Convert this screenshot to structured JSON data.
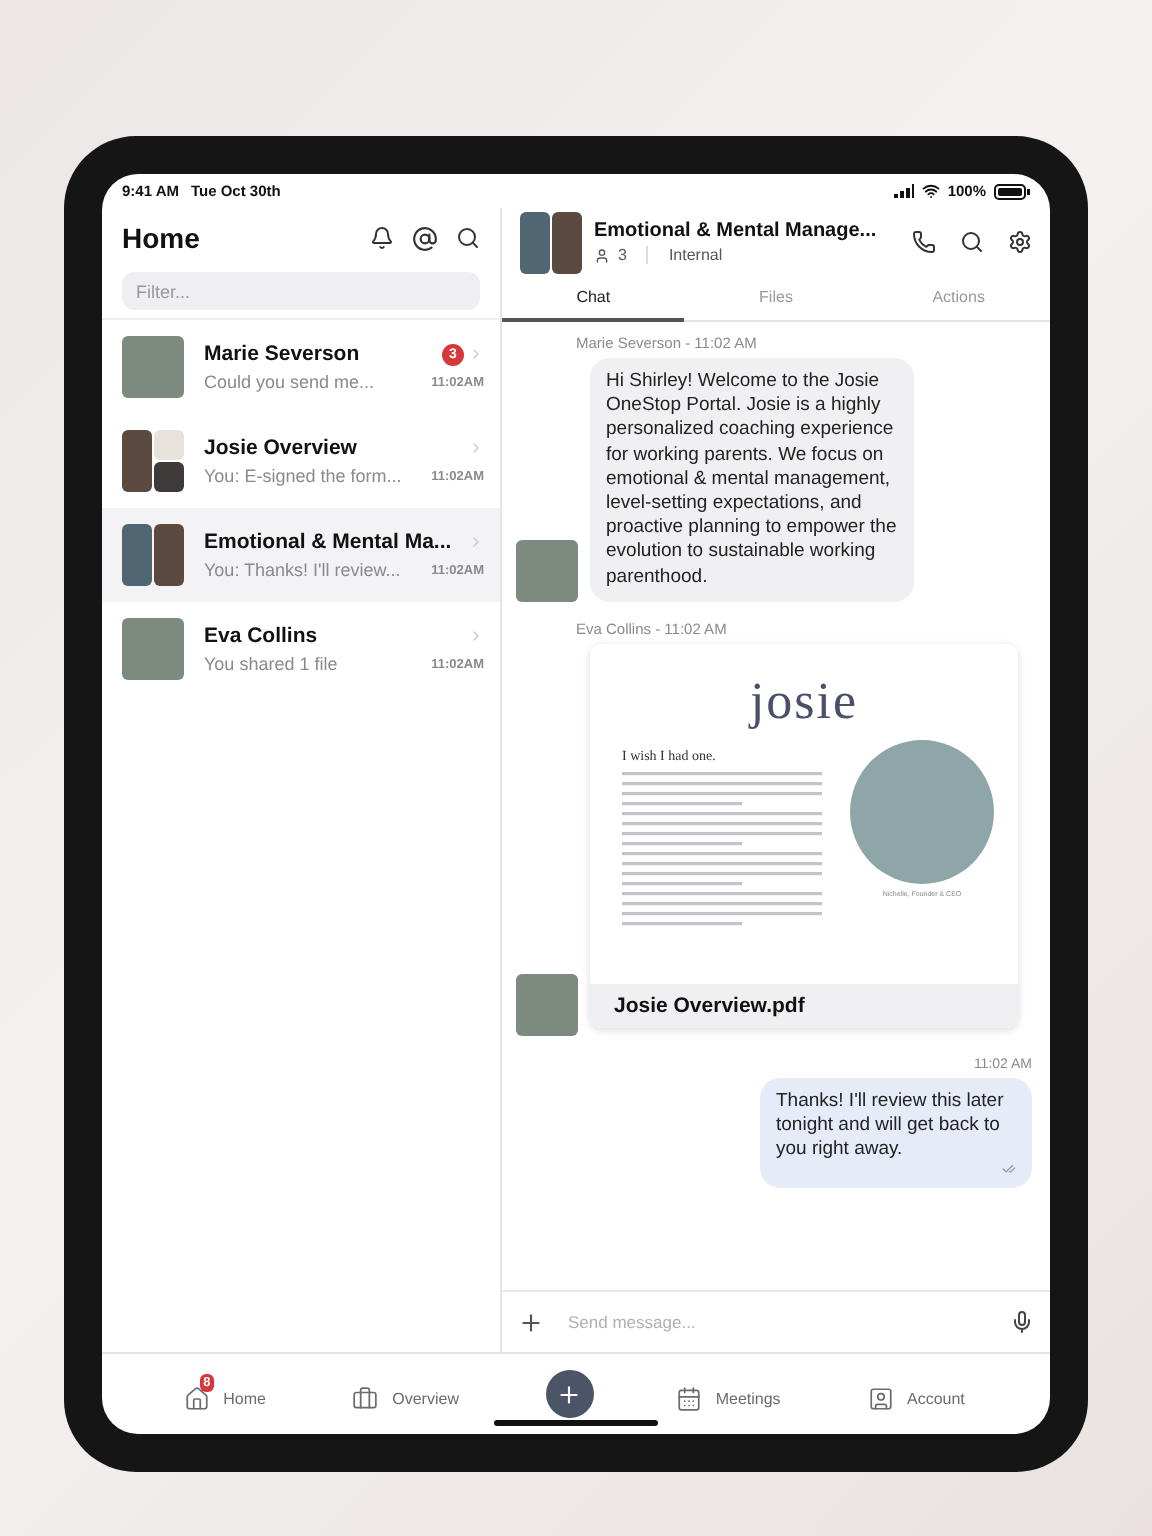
{
  "status_bar": {
    "time": "9:41 AM",
    "date": "Tue Oct 30th",
    "battery": "100%"
  },
  "sidebar": {
    "title": "Home",
    "filter": {
      "placeholder": "Filter..."
    },
    "conversations": [
      {
        "name": "Marie Severson",
        "preview": "Could you send me...",
        "time": "11:02AM",
        "unread": "3",
        "kind": "single",
        "selected": false
      },
      {
        "name": "Josie Overview",
        "preview": "You: E-signed the form...",
        "time": "11:02AM",
        "kind": "trio",
        "selected": false
      },
      {
        "name": "Emotional & Mental Ma...",
        "preview": "You: Thanks! I'll review...",
        "time": "11:02AM",
        "kind": "pair",
        "selected": true
      },
      {
        "name": "Eva Collins",
        "preview": "You shared 1 file",
        "time": "11:02AM",
        "kind": "single",
        "selected": false
      }
    ]
  },
  "conversation": {
    "title": "Emotional & Mental Manage...",
    "members": "3",
    "tag": "Internal",
    "tabs": [
      {
        "label": "Chat",
        "selected": true
      },
      {
        "label": "Files",
        "selected": false
      },
      {
        "label": "Actions",
        "selected": false
      }
    ],
    "messages": [
      {
        "kind": "incoming",
        "sender_line": "Marie Severson - 11:02 AM",
        "text": "Hi Shirley! Welcome to the Josie OneStop Portal. Josie is a highly personalized coaching experience for working parents. We focus on emotional & mental management, level-setting expectations, and proactive planning to empower the evolution to sustainable working parenthood."
      },
      {
        "kind": "file",
        "sender_line": "Eva Collins - 11:02 AM",
        "document": {
          "logo": "josie",
          "heading": "I wish I had one.",
          "caption": "Nichelle, Founder & CEO"
        },
        "file_name": "Josie Overview.pdf"
      },
      {
        "kind": "outgoing",
        "time": "11:02 AM",
        "text": "Thanks! I'll review this later tonight and will get back to you right away.",
        "read": true
      }
    ],
    "composer": {
      "placeholder": "Send message..."
    }
  },
  "bottom_nav": [
    {
      "label": "Home",
      "kind": "home",
      "badge": "8"
    },
    {
      "label": "Overview",
      "kind": "overview"
    },
    {
      "label": "Meetings",
      "kind": "meetings"
    },
    {
      "label": "Account",
      "kind": "account"
    }
  ]
}
